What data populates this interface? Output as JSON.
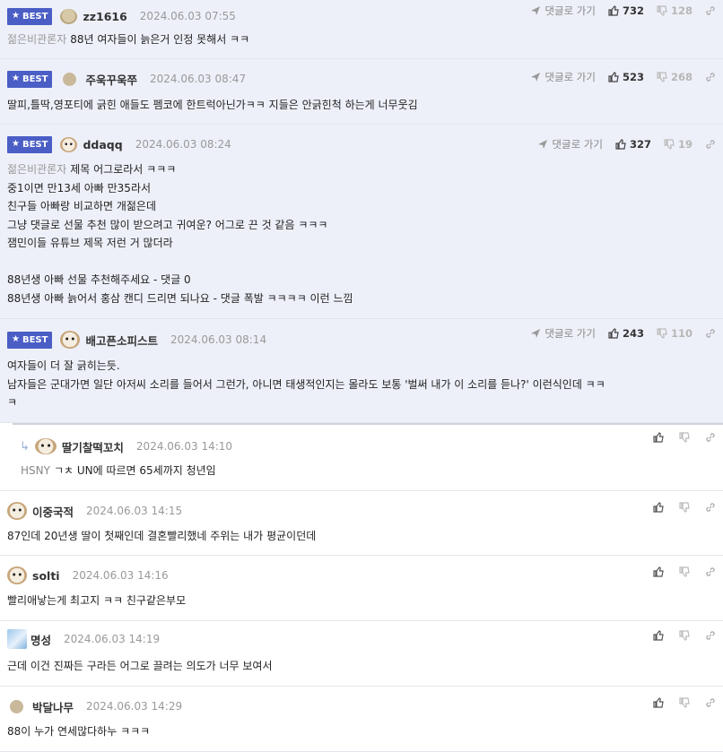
{
  "labels": {
    "best": "BEST",
    "goto_reply": "댓글로 가기"
  },
  "colors": {
    "best_badge": "#4a5ec5",
    "best_row_bg": "#eef0f9"
  },
  "icons": {
    "best": "star-icon",
    "goto": "send-arrow-icon",
    "like": "thumbs-up-icon",
    "dislike": "thumbs-down-icon",
    "share": "link-icon",
    "reply": "reply-arrow-icon"
  },
  "comments": [
    {
      "best": true,
      "nickname": "zz1616",
      "date": "2024.06.03 07:55",
      "likes": "732",
      "dislikes": "128",
      "prefix": "젊은비관론자",
      "lines": [
        "88년 여자들이 늙은거 인정 못해서 ㅋㅋ"
      ]
    },
    {
      "best": true,
      "nickname": "주욱꾸욱쭈",
      "date": "2024.06.03 08:47",
      "likes": "523",
      "dislikes": "268",
      "prefix": "",
      "lines": [
        "딸피,틀딱,영포티에 긁힌 애들도 펨코에 한트럭아닌가ㅋㅋ 지들은 안긁힌척 하는게 너무웃김"
      ]
    },
    {
      "best": true,
      "nickname": "ddaqq",
      "date": "2024.06.03 08:24",
      "likes": "327",
      "dislikes": "19",
      "prefix": "젊은비관론자",
      "lines": [
        "제목 어그로라서 ㅋㅋㅋ",
        "중1이면 만13세 아빠 만35라서",
        "친구들 아빠랑 비교하면 개젊은데",
        "그냥 댓글로 선물 추천 많이 받으려고 귀여운? 어그로 끈 것 같음 ㅋㅋㅋ",
        "잼민이들 유튜브 제목 저런 거 많더라",
        "",
        "88년생 아빠 선물 추천해주세요 - 댓글 0",
        "88년생 아빠 늙어서 홍삼 캔디 드리면 되나요 - 댓글 폭발 ㅋㅋㅋㅋ 이런 느낌"
      ]
    },
    {
      "best": true,
      "nickname": "배고픈소피스트",
      "date": "2024.06.03 08:14",
      "likes": "243",
      "dislikes": "110",
      "prefix": "",
      "lines": [
        "여자들이 더 잘 긁히는듯.",
        "남자들은 군대가면 일단 아저씨 소리를 들어서 그런가, 아니면 태생적인지는 몰라도 보통 '벌써 내가 이 소리를 듣나?' 이런식인데 ㅋㅋ",
        "ㅋ"
      ]
    },
    {
      "best": false,
      "reply": true,
      "nickname": "딸기찰떡꼬치",
      "date": "2024.06.03 14:10",
      "prefix": "HSNY",
      "lines": [
        "ㄱㅊ UN에 따르면 65세까지 청년임"
      ]
    },
    {
      "best": false,
      "nickname": "이중국적",
      "date": "2024.06.03 14:15",
      "prefix": "",
      "lines": [
        "87인데 20년생 딸이 첫째인데 결혼빨리했네 주위는 내가 평균이던데"
      ]
    },
    {
      "best": false,
      "nickname": "solti",
      "date": "2024.06.03 14:16",
      "prefix": "",
      "lines": [
        "빨리애낳는게 최고지 ㅋㅋ 친구같은부모"
      ]
    },
    {
      "best": false,
      "nickname": "명성",
      "date": "2024.06.03 14:19",
      "prefix": "",
      "lines": [
        "근데 이건 진짜든 구라든 어그로 끌려는 의도가 너무 보여서"
      ]
    },
    {
      "best": false,
      "nickname": "박달나무",
      "date": "2024.06.03 14:29",
      "prefix": "",
      "lines": [
        "88이 누가 연세많다하누 ㅋㅋㅋ"
      ]
    }
  ]
}
